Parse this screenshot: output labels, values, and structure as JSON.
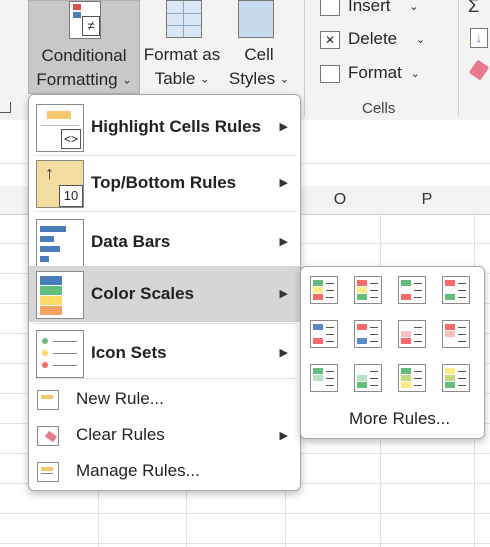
{
  "ribbon": {
    "conditional_formatting": {
      "line1": "Conditional",
      "line2": "Formatting"
    },
    "format_as_table": {
      "line1": "Format as",
      "line2": "Table"
    },
    "cell_styles": {
      "line1": "Cell",
      "line2": "Styles"
    },
    "insert": "Insert",
    "delete": "Delete",
    "format": "Format",
    "cells_group_label": "Cells",
    "chevron": "⌄"
  },
  "columns": [
    "O",
    "P"
  ],
  "menu": {
    "items": [
      {
        "label": "Highlight Cells Rules",
        "icon": "highlight-cells-rules-icon",
        "submenu": true
      },
      {
        "label": "Top/Bottom Rules",
        "icon": "top-bottom-rules-icon",
        "submenu": true,
        "icon_number": "10"
      },
      {
        "label": "Data Bars",
        "icon": "data-bars-icon",
        "submenu": true
      },
      {
        "label": "Color Scales",
        "icon": "color-scales-icon",
        "submenu": true,
        "highlighted": true
      },
      {
        "label": "Icon Sets",
        "icon": "icon-sets-icon",
        "submenu": true
      },
      {
        "label": "New Rule...",
        "icon": "new-rule-icon",
        "submenu": false
      },
      {
        "label": "Clear Rules",
        "icon": "clear-rules-icon",
        "submenu": true
      },
      {
        "label": "Manage Rules...",
        "icon": "manage-rules-icon",
        "submenu": false
      }
    ],
    "arrow_glyph": "▶"
  },
  "color_scales": {
    "swatches": [
      {
        "name": "green-yellow-red",
        "colors": [
          "#63be7b",
          "#ffeb84",
          "#f8696b"
        ]
      },
      {
        "name": "red-yellow-green",
        "colors": [
          "#f8696b",
          "#ffeb84",
          "#63be7b"
        ]
      },
      {
        "name": "green-white-red",
        "colors": [
          "#63be7b",
          "#fcfcff",
          "#f8696b"
        ]
      },
      {
        "name": "red-white-green",
        "colors": [
          "#f8696b",
          "#fcfcff",
          "#63be7b"
        ]
      },
      {
        "name": "blue-white-red",
        "colors": [
          "#5a8ac6",
          "#fcfcff",
          "#f8696b"
        ]
      },
      {
        "name": "red-white-blue",
        "colors": [
          "#f8696b",
          "#fcfcff",
          "#5a8ac6"
        ]
      },
      {
        "name": "white-red",
        "colors": [
          "#fcfcff",
          "#f8c0c0",
          "#f8696b"
        ]
      },
      {
        "name": "red-white",
        "colors": [
          "#f8696b",
          "#f8c0c0",
          "#fcfcff"
        ]
      },
      {
        "name": "green-white",
        "colors": [
          "#63be7b",
          "#b8e0c2",
          "#fcfcff"
        ]
      },
      {
        "name": "white-green",
        "colors": [
          "#fcfcff",
          "#b8e0c2",
          "#63be7b"
        ]
      },
      {
        "name": "green-yellow",
        "colors": [
          "#63be7b",
          "#c4d97e",
          "#ffeb84"
        ]
      },
      {
        "name": "yellow-green",
        "colors": [
          "#ffeb84",
          "#c4d97e",
          "#63be7b"
        ]
      }
    ],
    "more_rules": "More Rules..."
  }
}
